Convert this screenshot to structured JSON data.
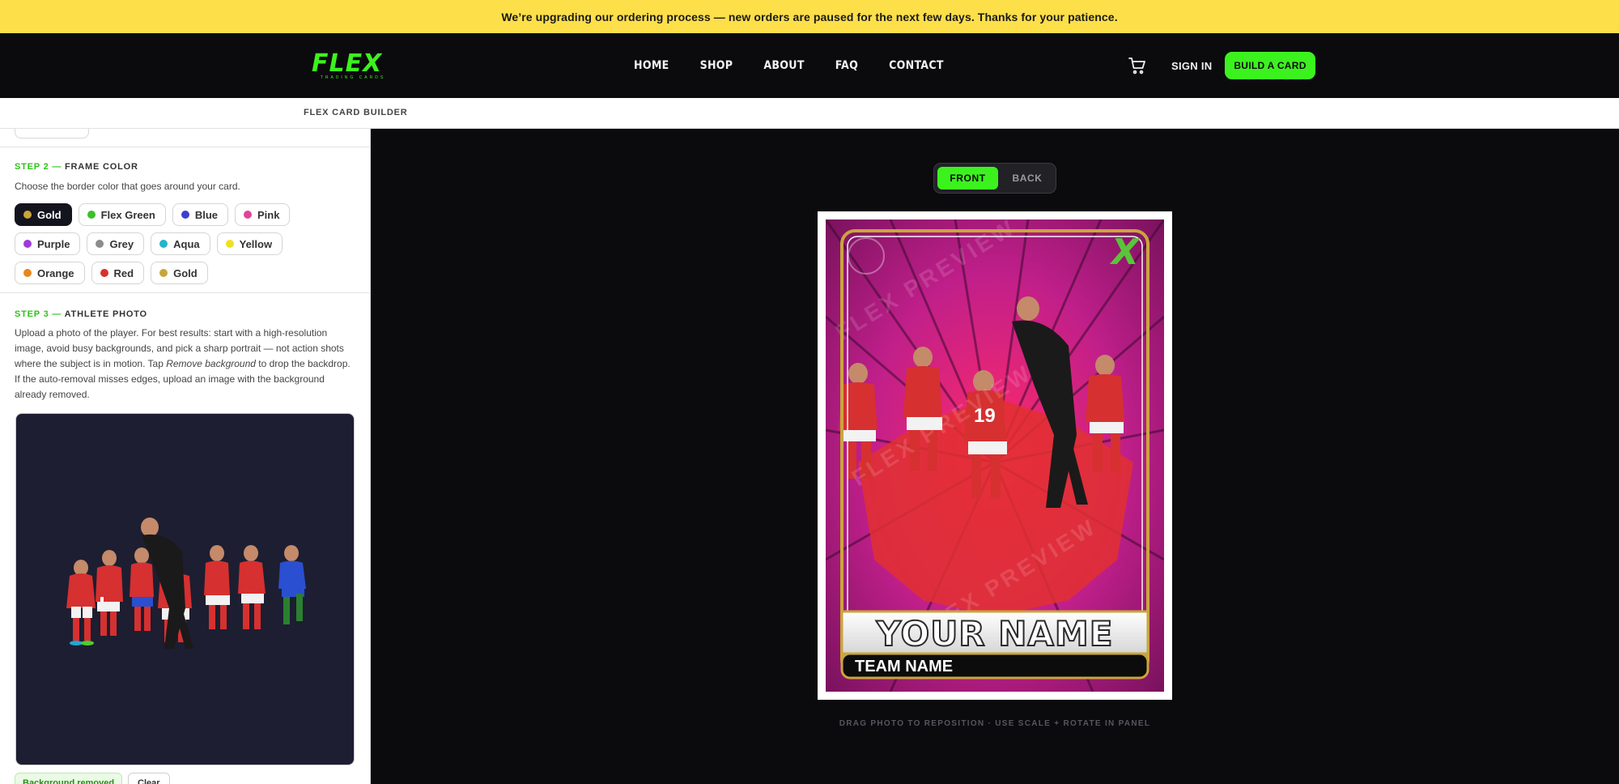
{
  "announcement": "We’re upgrading our ordering process — new orders are paused for the next few days. Thanks for your patience.",
  "header": {
    "logo_text": "FLEX",
    "logo_subtext": "TRADING CARDS",
    "nav": [
      "HOME",
      "SHOP",
      "ABOUT",
      "FAQ",
      "CONTACT"
    ],
    "cart_icon": "shopping-cart-icon",
    "signin_label": "SIGN IN",
    "build_label": "BUILD A CARD"
  },
  "subbar": {
    "title": "FLEX CARD BUILDER"
  },
  "step2": {
    "number": "STEP 2 —",
    "title": "FRAME COLOR",
    "description": "Choose the border color that goes around your card.",
    "selected": "Gold",
    "colors": [
      {
        "label": "Gold",
        "hex": "#c9a63c"
      },
      {
        "label": "Flex Green",
        "hex": "#3cc02a"
      },
      {
        "label": "Blue",
        "hex": "#3f3fcf"
      },
      {
        "label": "Pink",
        "hex": "#e0449a"
      },
      {
        "label": "Purple",
        "hex": "#a13ad6"
      },
      {
        "label": "Grey",
        "hex": "#8c8c8c"
      },
      {
        "label": "Aqua",
        "hex": "#23b4cf"
      },
      {
        "label": "Yellow",
        "hex": "#f0e020"
      },
      {
        "label": "Orange",
        "hex": "#e8861e"
      },
      {
        "label": "Red",
        "hex": "#d9302b"
      },
      {
        "label": "Gold",
        "hex": "#c9a63c"
      }
    ]
  },
  "step3": {
    "number": "STEP 3 —",
    "title": "ATHLETE PHOTO",
    "desc_before": "Upload a photo of the player. For best results: start with a high-resolution image, avoid busy backgrounds, and pick a sharp portrait — not action shots where the subject is in motion. Tap ",
    "desc_em": "Remove background",
    "desc_after": " to drop the backdrop. If the auto-removal misses edges, upload an image with the background already removed.",
    "badge": "Background removed",
    "clear_label": "Clear"
  },
  "preview": {
    "front_label": "FRONT",
    "back_label": "BACK",
    "active_side": "FRONT",
    "card_name": "YOUR NAME",
    "team_name": "TEAM NAME",
    "watermark": "FLEX PREVIEW",
    "hint": "DRAG PHOTO TO REPOSITION · USE SCALE + ROTATE IN PANEL"
  },
  "colors": {
    "accent": "#3cf21e",
    "announce_bg": "#fddf4a",
    "frame_gold": "#c9a63c",
    "card_bg": "#b0268f"
  }
}
